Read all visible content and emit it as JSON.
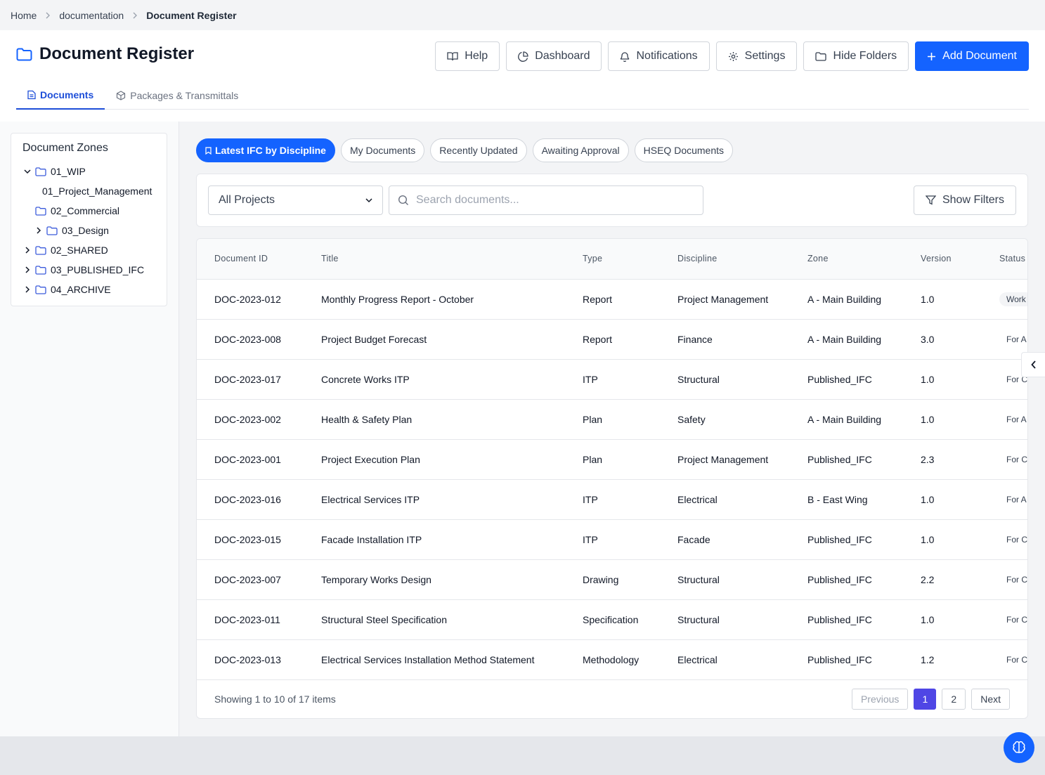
{
  "breadcrumb": {
    "items": [
      "Home",
      "documentation"
    ],
    "current": "Document Register"
  },
  "header": {
    "title": "Document Register",
    "actions": {
      "help": "Help",
      "dashboard": "Dashboard",
      "notifications": "Notifications",
      "settings": "Settings",
      "hide_folders": "Hide Folders",
      "add_document": "Add Document"
    },
    "tabs": {
      "documents": "Documents",
      "packages": "Packages & Transmittals"
    }
  },
  "sidebar": {
    "title": "Document Zones",
    "tree": [
      {
        "label": "01_WIP",
        "expanded": true
      },
      {
        "label": "01_Project_Management"
      },
      {
        "label": "02_Commercial"
      },
      {
        "label": "03_Design",
        "expanded": false
      },
      {
        "label": "02_SHARED",
        "expanded": false
      },
      {
        "label": "03_PUBLISHED_IFC",
        "expanded": false
      },
      {
        "label": "04_ARCHIVE",
        "expanded": false
      }
    ]
  },
  "pills": [
    "Latest IFC by Discipline",
    "My Documents",
    "Recently Updated",
    "Awaiting Approval",
    "HSEQ Documents"
  ],
  "filters": {
    "project_select": "All Projects",
    "search_placeholder": "Search documents...",
    "show_filters": "Show Filters"
  },
  "table": {
    "columns": [
      "Document ID",
      "Title",
      "Type",
      "Discipline",
      "Zone",
      "Version",
      "Status"
    ],
    "rows": [
      {
        "id": "DOC-2023-012",
        "title": "Monthly Progress Report - October",
        "type": "Report",
        "discipline": "Project Management",
        "zone": "A - Main Building",
        "version": "1.0",
        "status": "Work"
      },
      {
        "id": "DOC-2023-008",
        "title": "Project Budget Forecast",
        "type": "Report",
        "discipline": "Finance",
        "zone": "A - Main Building",
        "version": "3.0",
        "status": "For A"
      },
      {
        "id": "DOC-2023-017",
        "title": "Concrete Works ITP",
        "type": "ITP",
        "discipline": "Structural",
        "zone": "Published_IFC",
        "version": "1.0",
        "status": "For C"
      },
      {
        "id": "DOC-2023-002",
        "title": "Health & Safety Plan",
        "type": "Plan",
        "discipline": "Safety",
        "zone": "A - Main Building",
        "version": "1.0",
        "status": "For A"
      },
      {
        "id": "DOC-2023-001",
        "title": "Project Execution Plan",
        "type": "Plan",
        "discipline": "Project Management",
        "zone": "Published_IFC",
        "version": "2.3",
        "status": "For C"
      },
      {
        "id": "DOC-2023-016",
        "title": "Electrical Services ITP",
        "type": "ITP",
        "discipline": "Electrical",
        "zone": "B - East Wing",
        "version": "1.0",
        "status": "For A"
      },
      {
        "id": "DOC-2023-015",
        "title": "Facade Installation ITP",
        "type": "ITP",
        "discipline": "Facade",
        "zone": "Published_IFC",
        "version": "1.0",
        "status": "For C"
      },
      {
        "id": "DOC-2023-007",
        "title": "Temporary Works Design",
        "type": "Drawing",
        "discipline": "Structural",
        "zone": "Published_IFC",
        "version": "2.2",
        "status": "For C"
      },
      {
        "id": "DOC-2023-011",
        "title": "Structural Steel Specification",
        "type": "Specification",
        "discipline": "Structural",
        "zone": "Published_IFC",
        "version": "1.0",
        "status": "For C"
      },
      {
        "id": "DOC-2023-013",
        "title": "Electrical Services Installation Method Statement",
        "type": "Methodology",
        "discipline": "Electrical",
        "zone": "Published_IFC",
        "version": "1.2",
        "status": "For C"
      }
    ]
  },
  "pagination": {
    "summary": "Showing 1 to 10 of 17 items",
    "previous": "Previous",
    "pages": [
      "1",
      "2"
    ],
    "next": "Next"
  },
  "colors": {
    "primary": "#1463ff",
    "active_page": "#4f46e5",
    "folder": "#3b5bdb"
  }
}
